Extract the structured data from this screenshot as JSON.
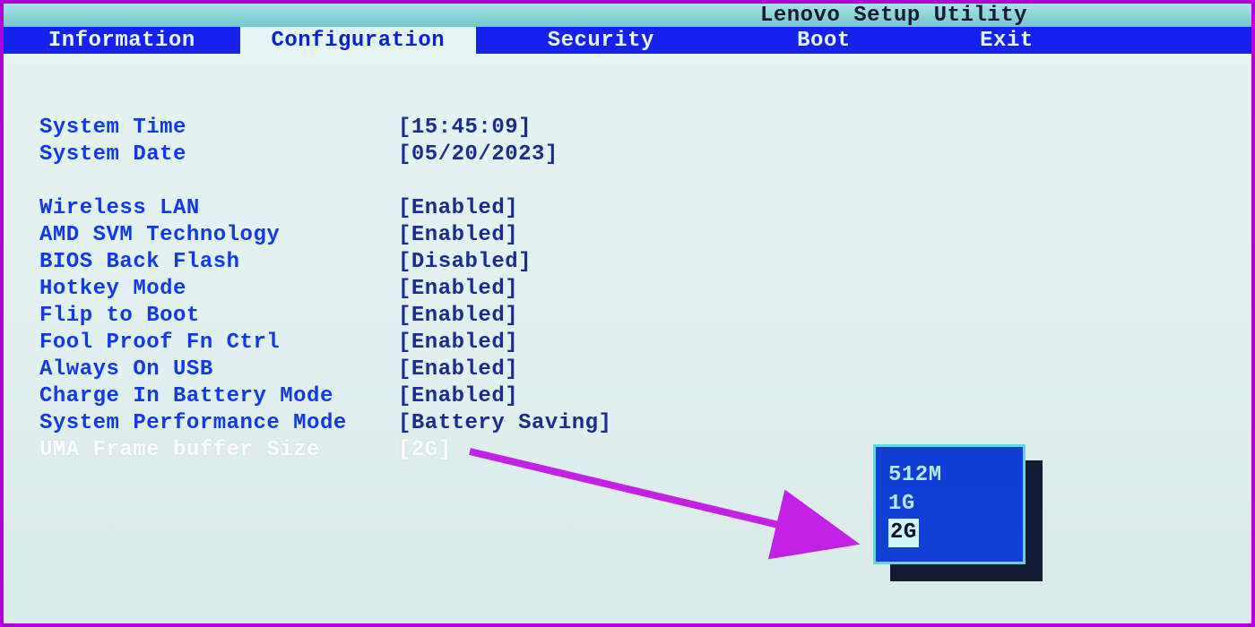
{
  "title": "Lenovo Setup Utility",
  "tabs": {
    "information": "Information",
    "configuration": "Configuration",
    "security": "Security",
    "boot": "Boot",
    "exit": "Exit"
  },
  "settings": {
    "system_time": {
      "label": "System Time",
      "value": "[15:45:09]"
    },
    "system_date": {
      "label": "System Date",
      "value": "[05/20/2023]"
    },
    "wireless_lan": {
      "label": "Wireless LAN",
      "value": "[Enabled]"
    },
    "amd_svm": {
      "label": "AMD SVM Technology",
      "value": "[Enabled]"
    },
    "bios_back_flash": {
      "label": "BIOS Back Flash",
      "value": "[Disabled]"
    },
    "hotkey_mode": {
      "label": "Hotkey Mode",
      "value": "[Enabled]"
    },
    "flip_to_boot": {
      "label": "Flip to Boot",
      "value": "[Enabled]"
    },
    "fool_proof_fn": {
      "label": "Fool Proof Fn Ctrl",
      "value": "[Enabled]"
    },
    "always_on_usb": {
      "label": "Always On USB",
      "value": "[Enabled]"
    },
    "charge_battery": {
      "label": "Charge In Battery Mode",
      "value": "[Enabled]"
    },
    "perf_mode": {
      "label": "System Performance Mode",
      "value": "[Battery Saving]"
    },
    "uma_frame_buffer": {
      "label": "UMA Frame buffer Size",
      "value": "[2G]"
    }
  },
  "popup": {
    "options": [
      "512M",
      "1G",
      "2G"
    ],
    "selected": "2G"
  },
  "arrow_color": "#c322e6"
}
